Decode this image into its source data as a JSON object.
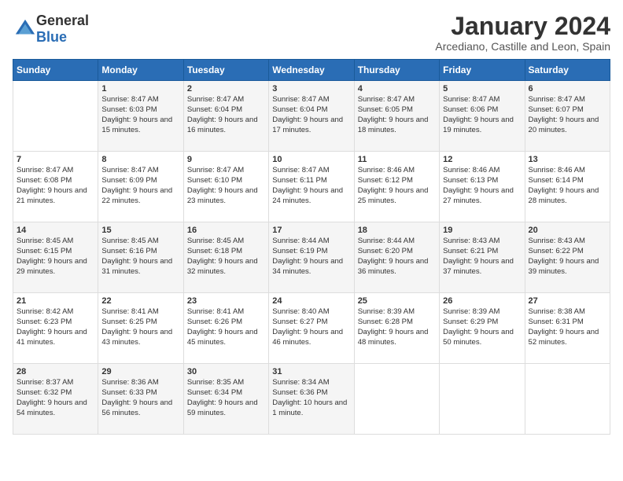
{
  "header": {
    "logo_general": "General",
    "logo_blue": "Blue",
    "month_title": "January 2024",
    "location": "Arcediano, Castille and Leon, Spain"
  },
  "days_of_week": [
    "Sunday",
    "Monday",
    "Tuesday",
    "Wednesday",
    "Thursday",
    "Friday",
    "Saturday"
  ],
  "weeks": [
    [
      {
        "day": "",
        "sunrise": "",
        "sunset": "",
        "daylight": ""
      },
      {
        "day": "1",
        "sunrise": "Sunrise: 8:47 AM",
        "sunset": "Sunset: 6:03 PM",
        "daylight": "Daylight: 9 hours and 15 minutes."
      },
      {
        "day": "2",
        "sunrise": "Sunrise: 8:47 AM",
        "sunset": "Sunset: 6:04 PM",
        "daylight": "Daylight: 9 hours and 16 minutes."
      },
      {
        "day": "3",
        "sunrise": "Sunrise: 8:47 AM",
        "sunset": "Sunset: 6:04 PM",
        "daylight": "Daylight: 9 hours and 17 minutes."
      },
      {
        "day": "4",
        "sunrise": "Sunrise: 8:47 AM",
        "sunset": "Sunset: 6:05 PM",
        "daylight": "Daylight: 9 hours and 18 minutes."
      },
      {
        "day": "5",
        "sunrise": "Sunrise: 8:47 AM",
        "sunset": "Sunset: 6:06 PM",
        "daylight": "Daylight: 9 hours and 19 minutes."
      },
      {
        "day": "6",
        "sunrise": "Sunrise: 8:47 AM",
        "sunset": "Sunset: 6:07 PM",
        "daylight": "Daylight: 9 hours and 20 minutes."
      }
    ],
    [
      {
        "day": "7",
        "sunrise": "Sunrise: 8:47 AM",
        "sunset": "Sunset: 6:08 PM",
        "daylight": "Daylight: 9 hours and 21 minutes."
      },
      {
        "day": "8",
        "sunrise": "Sunrise: 8:47 AM",
        "sunset": "Sunset: 6:09 PM",
        "daylight": "Daylight: 9 hours and 22 minutes."
      },
      {
        "day": "9",
        "sunrise": "Sunrise: 8:47 AM",
        "sunset": "Sunset: 6:10 PM",
        "daylight": "Daylight: 9 hours and 23 minutes."
      },
      {
        "day": "10",
        "sunrise": "Sunrise: 8:47 AM",
        "sunset": "Sunset: 6:11 PM",
        "daylight": "Daylight: 9 hours and 24 minutes."
      },
      {
        "day": "11",
        "sunrise": "Sunrise: 8:46 AM",
        "sunset": "Sunset: 6:12 PM",
        "daylight": "Daylight: 9 hours and 25 minutes."
      },
      {
        "day": "12",
        "sunrise": "Sunrise: 8:46 AM",
        "sunset": "Sunset: 6:13 PM",
        "daylight": "Daylight: 9 hours and 27 minutes."
      },
      {
        "day": "13",
        "sunrise": "Sunrise: 8:46 AM",
        "sunset": "Sunset: 6:14 PM",
        "daylight": "Daylight: 9 hours and 28 minutes."
      }
    ],
    [
      {
        "day": "14",
        "sunrise": "Sunrise: 8:45 AM",
        "sunset": "Sunset: 6:15 PM",
        "daylight": "Daylight: 9 hours and 29 minutes."
      },
      {
        "day": "15",
        "sunrise": "Sunrise: 8:45 AM",
        "sunset": "Sunset: 6:16 PM",
        "daylight": "Daylight: 9 hours and 31 minutes."
      },
      {
        "day": "16",
        "sunrise": "Sunrise: 8:45 AM",
        "sunset": "Sunset: 6:18 PM",
        "daylight": "Daylight: 9 hours and 32 minutes."
      },
      {
        "day": "17",
        "sunrise": "Sunrise: 8:44 AM",
        "sunset": "Sunset: 6:19 PM",
        "daylight": "Daylight: 9 hours and 34 minutes."
      },
      {
        "day": "18",
        "sunrise": "Sunrise: 8:44 AM",
        "sunset": "Sunset: 6:20 PM",
        "daylight": "Daylight: 9 hours and 36 minutes."
      },
      {
        "day": "19",
        "sunrise": "Sunrise: 8:43 AM",
        "sunset": "Sunset: 6:21 PM",
        "daylight": "Daylight: 9 hours and 37 minutes."
      },
      {
        "day": "20",
        "sunrise": "Sunrise: 8:43 AM",
        "sunset": "Sunset: 6:22 PM",
        "daylight": "Daylight: 9 hours and 39 minutes."
      }
    ],
    [
      {
        "day": "21",
        "sunrise": "Sunrise: 8:42 AM",
        "sunset": "Sunset: 6:23 PM",
        "daylight": "Daylight: 9 hours and 41 minutes."
      },
      {
        "day": "22",
        "sunrise": "Sunrise: 8:41 AM",
        "sunset": "Sunset: 6:25 PM",
        "daylight": "Daylight: 9 hours and 43 minutes."
      },
      {
        "day": "23",
        "sunrise": "Sunrise: 8:41 AM",
        "sunset": "Sunset: 6:26 PM",
        "daylight": "Daylight: 9 hours and 45 minutes."
      },
      {
        "day": "24",
        "sunrise": "Sunrise: 8:40 AM",
        "sunset": "Sunset: 6:27 PM",
        "daylight": "Daylight: 9 hours and 46 minutes."
      },
      {
        "day": "25",
        "sunrise": "Sunrise: 8:39 AM",
        "sunset": "Sunset: 6:28 PM",
        "daylight": "Daylight: 9 hours and 48 minutes."
      },
      {
        "day": "26",
        "sunrise": "Sunrise: 8:39 AM",
        "sunset": "Sunset: 6:29 PM",
        "daylight": "Daylight: 9 hours and 50 minutes."
      },
      {
        "day": "27",
        "sunrise": "Sunrise: 8:38 AM",
        "sunset": "Sunset: 6:31 PM",
        "daylight": "Daylight: 9 hours and 52 minutes."
      }
    ],
    [
      {
        "day": "28",
        "sunrise": "Sunrise: 8:37 AM",
        "sunset": "Sunset: 6:32 PM",
        "daylight": "Daylight: 9 hours and 54 minutes."
      },
      {
        "day": "29",
        "sunrise": "Sunrise: 8:36 AM",
        "sunset": "Sunset: 6:33 PM",
        "daylight": "Daylight: 9 hours and 56 minutes."
      },
      {
        "day": "30",
        "sunrise": "Sunrise: 8:35 AM",
        "sunset": "Sunset: 6:34 PM",
        "daylight": "Daylight: 9 hours and 59 minutes."
      },
      {
        "day": "31",
        "sunrise": "Sunrise: 8:34 AM",
        "sunset": "Sunset: 6:36 PM",
        "daylight": "Daylight: 10 hours and 1 minute."
      },
      {
        "day": "",
        "sunrise": "",
        "sunset": "",
        "daylight": ""
      },
      {
        "day": "",
        "sunrise": "",
        "sunset": "",
        "daylight": ""
      },
      {
        "day": "",
        "sunrise": "",
        "sunset": "",
        "daylight": ""
      }
    ]
  ]
}
